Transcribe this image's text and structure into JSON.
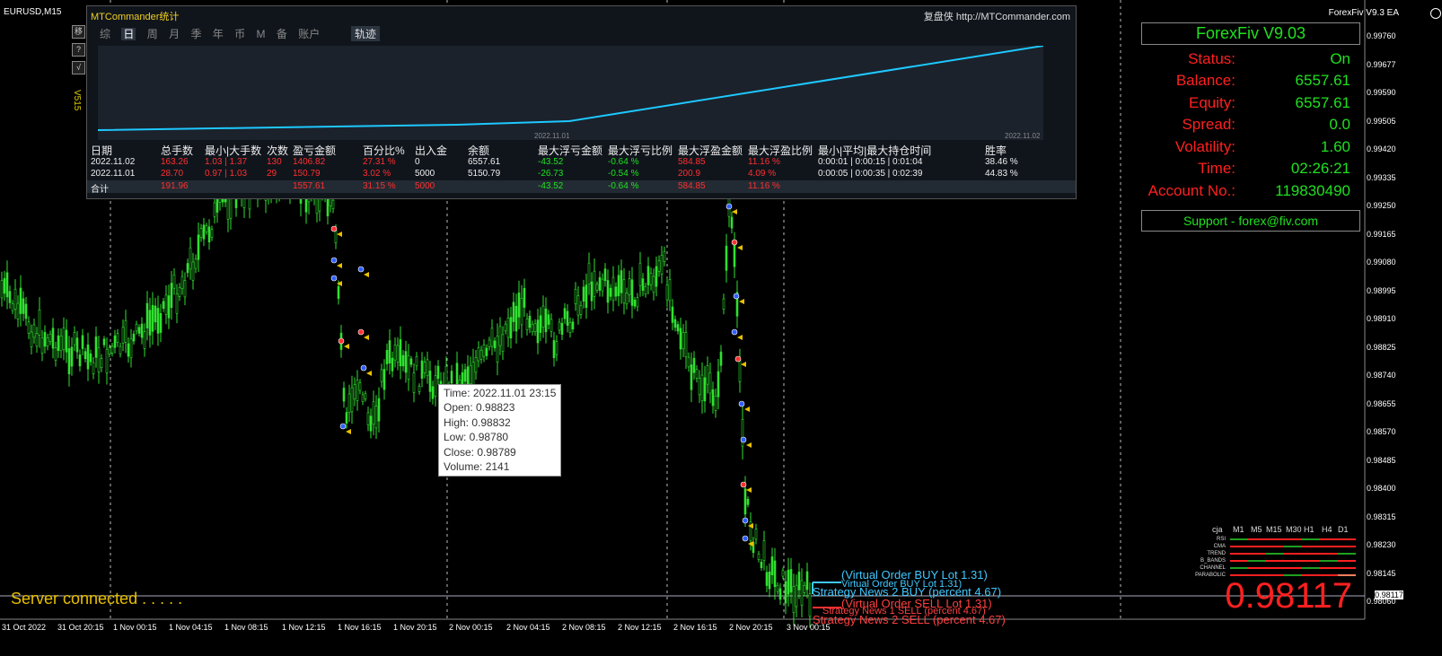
{
  "symbol": "EURUSD,M15",
  "toolbar": {
    "buttons": [
      "移",
      "?",
      "√"
    ],
    "version_label": "V515"
  },
  "stats": {
    "title": "MTCommander统计",
    "link": "复盘侠 http://MTCommander.com",
    "tabs": [
      "综",
      "日",
      "周",
      "月",
      "季",
      "年",
      "币",
      "M",
      "备",
      "账户"
    ],
    "active_tab": "日",
    "track_label": "轨迹",
    "plot_ticks": {
      "mid": "2022.11.01",
      "right": "2022.11.02"
    },
    "headers": [
      "日期",
      "总手数",
      "最小|大手数",
      "次数",
      "盈亏金额",
      "百分比%",
      "出入金",
      "余额",
      "最大浮亏金额",
      "最大浮亏比例",
      "最大浮盈金额",
      "最大浮盈比例",
      "最小|平均|最大持仓时间",
      "胜率"
    ],
    "rows": [
      [
        "2022.11.02",
        "163.26",
        "1.03 | 1.37",
        "130",
        "1406.82",
        "27.31 %",
        "0",
        "6557.61",
        "-43.52",
        "-0.64 %",
        "584.85",
        "11.16 %",
        "0:00:01 | 0:00:15 | 0:01:04",
        "38.46 %"
      ],
      [
        "2022.11.01",
        "28.70",
        "0.97 | 1.03",
        "29",
        "150.79",
        "3.02 %",
        "5000",
        "5150.79",
        "-26.73",
        "-0.54 %",
        "200.9",
        "4.09 %",
        "0:00:05 | 0:00:35 | 0:02:39",
        "44.83 %"
      ]
    ],
    "total": [
      "合计",
      "191.96",
      "1557.61",
      "31.15 %",
      "5000",
      "-43.52",
      "-0.64 %",
      "584.85",
      "11.16 %"
    ]
  },
  "tooltip": {
    "time": "Time: 2022.11.01 23:15",
    "open": "Open: 0.98823",
    "high": "High: 0.98832",
    "low": "Low:  0.98780",
    "close": "Close: 0.98789",
    "volume": "Volume: 2141"
  },
  "ea": {
    "header": "ForexFiv  V9.3 EA",
    "title": "ForexFiv  V9.03",
    "fields": [
      {
        "label": "Status:",
        "value": "On"
      },
      {
        "label": "Balance:",
        "value": "6557.61"
      },
      {
        "label": "Equity:",
        "value": "6557.61"
      },
      {
        "label": "Spread:",
        "value": "0.0"
      },
      {
        "label": "Volatility:",
        "value": "1.60"
      },
      {
        "label": "Time:",
        "value": "02:26:21"
      },
      {
        "label": "Account No.:",
        "value": "119830490"
      }
    ],
    "support": "Support - forex@fiv.com",
    "big_price": "0.98117"
  },
  "mtf": {
    "columns": [
      "cja",
      "M1",
      "M5",
      "M15",
      "M30",
      "H1",
      "H4",
      "D1"
    ],
    "rows": [
      "RSI",
      "CMA",
      "TREND",
      "B_BANDS",
      "CHANNEL",
      "PARABOLIC"
    ]
  },
  "status_text": "Server connected . . . . .",
  "price_tag": "0.98117",
  "annotations": [
    {
      "text": "(Virtual Order BUY Lot 1.31)",
      "color": "#40c8ff"
    },
    {
      "text": "Virtual Order BUY Lot 1.31)",
      "color": "#40c8ff"
    },
    {
      "text": "Strategy News 2 BUY (percent 4.67)",
      "color": "#40c8ff"
    },
    {
      "text": "(Virtual Order SELL Lot 1.31)",
      "color": "#ff4040"
    },
    {
      "text": "Strategy News 1 SELL (percent 4.67)",
      "color": "#ff4040"
    },
    {
      "text": "Strategy News 2 SELL (percent 4.67)",
      "color": "#ff4040"
    }
  ],
  "y_axis": [
    "0.99760",
    "0.99677",
    "0.99590",
    "0.99505",
    "0.99420",
    "0.99335",
    "0.99250",
    "0.99165",
    "0.99080",
    "0.98995",
    "0.98910",
    "0.98825",
    "0.98740",
    "0.98655",
    "0.98570",
    "0.98485",
    "0.98400",
    "0.98315",
    "0.98230",
    "0.98145",
    "0.98060"
  ],
  "x_axis": [
    "31 Oct 2022",
    "31 Oct 20:15",
    "1 Nov 00:15",
    "1 Nov 04:15",
    "1 Nov 08:15",
    "1 Nov 12:15",
    "1 Nov 16:15",
    "1 Nov 20:15",
    "2 Nov 00:15",
    "2 Nov 04:15",
    "2 Nov 08:15",
    "2 Nov 12:15",
    "2 Nov 16:15",
    "2 Nov 20:15",
    "3 Nov 00:15"
  ]
}
